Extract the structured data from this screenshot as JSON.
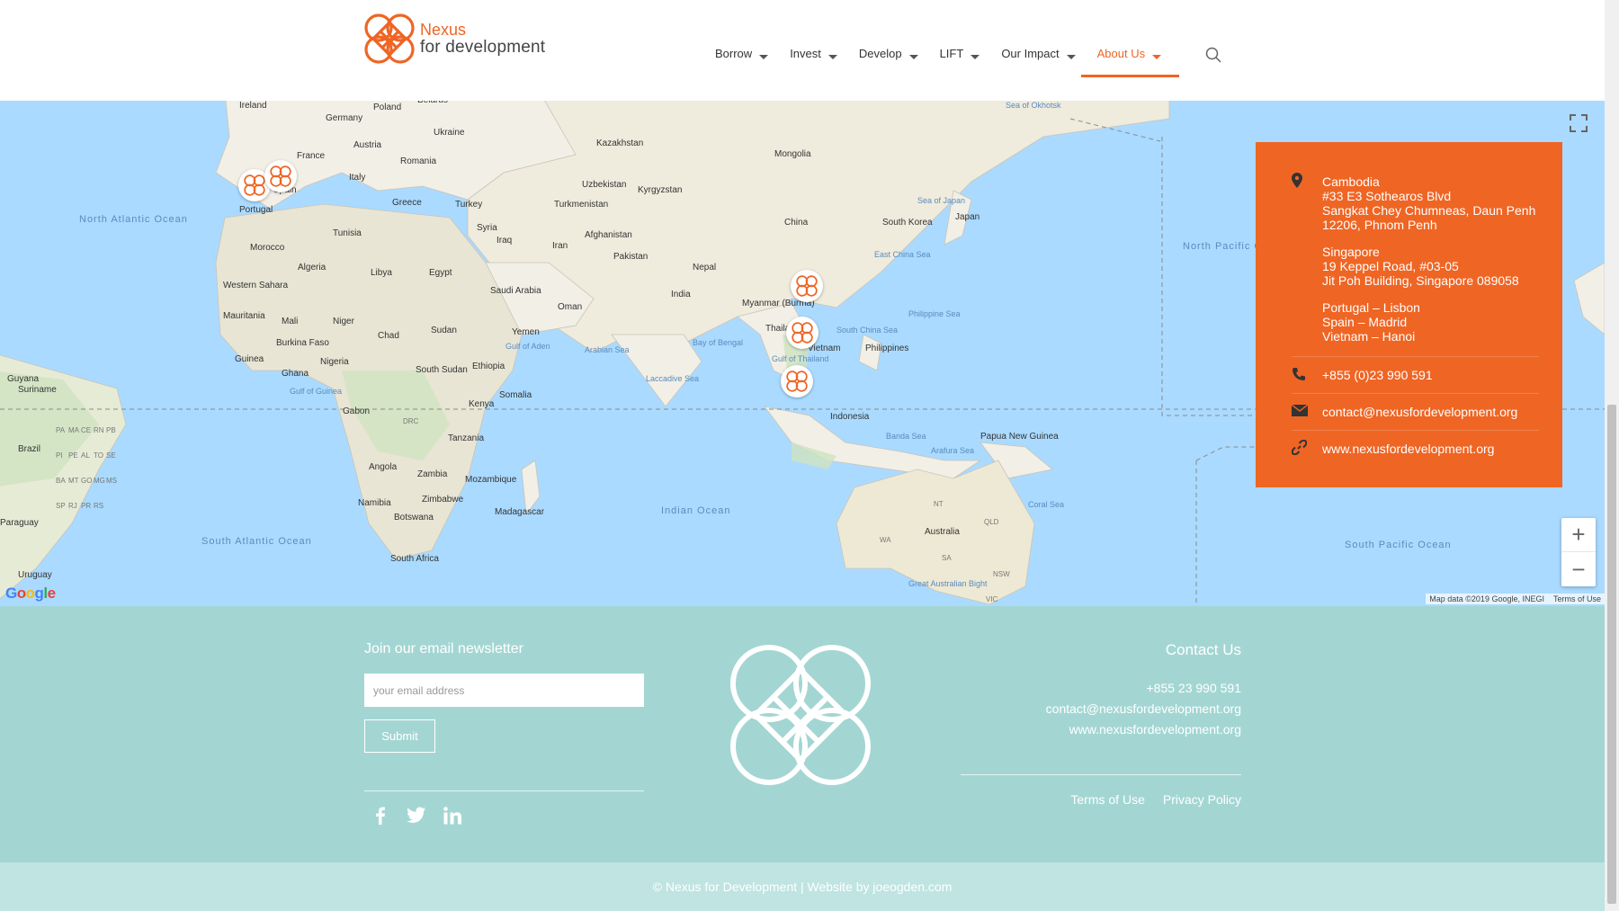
{
  "header": {
    "logo": {
      "line1": "Nexus",
      "line2": "for development"
    },
    "nav": [
      {
        "label": "Borrow"
      },
      {
        "label": "Invest"
      },
      {
        "label": "Develop"
      },
      {
        "label": "LIFT"
      },
      {
        "label": "Our Impact"
      },
      {
        "label": "About Us",
        "active": true
      }
    ],
    "accent_color": "#ef6524"
  },
  "map": {
    "countries": [
      "Ireland",
      "Poland",
      "Belarus",
      "Germany",
      "Ukraine",
      "Austria",
      "France",
      "Romania",
      "Kazakhstan",
      "Mongolia",
      "Italy",
      "Spain",
      "Portugal",
      "Greece",
      "Turkey",
      "Uzbekistan",
      "Kyrgyzstan",
      "Turkmenistan",
      "China",
      "South Korea",
      "Japan",
      "Tunisia",
      "Syria",
      "Iraq",
      "Afghanistan",
      "Iran",
      "Morocco",
      "Algeria",
      "Libya",
      "Egypt",
      "Saudi Arabia",
      "Pakistan",
      "Nepal",
      "India",
      "Myanmar (Burma)",
      "Thailand",
      "Vietnam",
      "Philippines",
      "Oman",
      "Western Sahara",
      "Mauritania",
      "Mali",
      "Niger",
      "Chad",
      "Sudan",
      "Yemen",
      "Burkina Faso",
      "Guinea",
      "Ghana",
      "Nigeria",
      "South Sudan",
      "Ethiopia",
      "Somalia",
      "Kenya",
      "Gabon",
      "DRC",
      "Tanzania",
      "Indonesia",
      "Papua New Guinea",
      "Angola",
      "Zambia",
      "Mozambique",
      "Namibia",
      "Zimbabwe",
      "Botswana",
      "Madagascar",
      "Australia",
      "South Africa",
      "Brazil",
      "Paraguay",
      "Uruguay",
      "Guyana",
      "Suriname"
    ],
    "oceans": [
      "North Atlantic Ocean",
      "South Atlantic Ocean",
      "Indian Ocean",
      "North Pacific Ocean",
      "South Pacific Ocean"
    ],
    "seas": [
      "Sea of Okhotsk",
      "Sea of Japan",
      "East China Sea",
      "Philippine Sea",
      "South China Sea",
      "Bay of Bengal",
      "Arabian Sea",
      "Gulf of Aden",
      "Gulf of Thailand",
      "Laccadive Sea",
      "Gulf of Guinea",
      "Banda Sea",
      "Arafura Sea",
      "Coral Sea",
      "Great Australian Bight"
    ],
    "au_states": [
      "NT",
      "QLD",
      "WA",
      "SA",
      "NSW",
      "VIC"
    ],
    "br_states": [
      "PA",
      "MA",
      "CE",
      "RN",
      "PB",
      "PI",
      "PE",
      "AL",
      "TO",
      "SE",
      "BA",
      "MT",
      "GO",
      "MG",
      "MS",
      "SP",
      "RJ",
      "PR",
      "RS"
    ],
    "attribution": "Map data ©2019 Google, INEGI",
    "terms": "Terms of Use",
    "google_logo": "Google",
    "zoom_in": "+",
    "zoom_out": "−"
  },
  "info_panel": {
    "cambodia": [
      "Cambodia",
      "#33 E3 Sothearos Blvd",
      "Sangkat Chey Chumneas, Daun Penh",
      "12206, Phnom Penh"
    ],
    "singapore": [
      "Singapore",
      "19 Keppel Road, #03-05",
      "Jit Poh Building, Singapore 089058"
    ],
    "others": [
      "Portugal – Lisbon",
      "Spain – Madrid",
      "Vietnam – Hanoi"
    ],
    "phone": "+855 (0)23 990 591",
    "email": "contact@nexusfordevelopment.org",
    "website": "www.nexusfordevelopment.org"
  },
  "footer": {
    "newsletter_title": "Join our email newsletter",
    "email_placeholder": "your email address",
    "submit_label": "Submit",
    "contact_title": "Contact Us",
    "contact_phone": "+855 23 990 591",
    "contact_email": "contact@nexusfordevelopment.org",
    "contact_website": "www.nexusfordevelopment.org",
    "terms": "Terms of Use",
    "privacy": "Privacy Policy",
    "copyright": "© Nexus for Development | Website by joeogden.com"
  }
}
